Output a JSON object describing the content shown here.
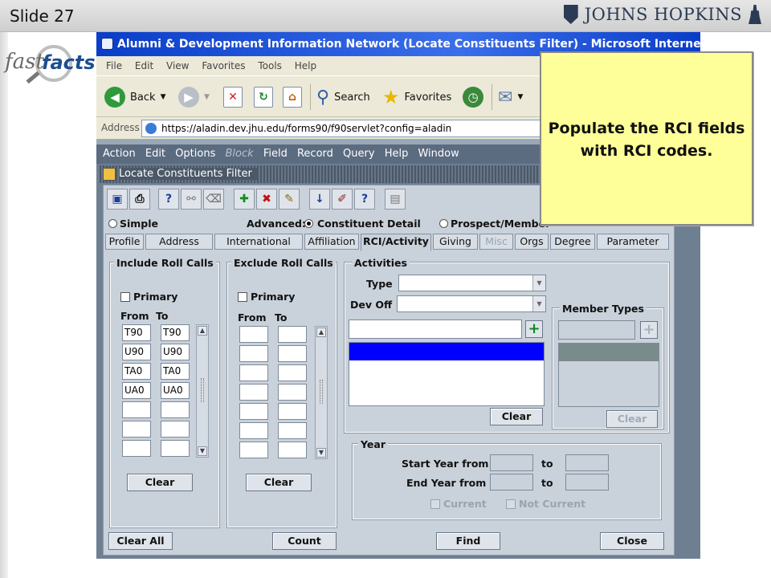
{
  "slide": {
    "number": "Slide 27",
    "logo_text": "JOHNS HOPKINS",
    "badge_fast": "fast",
    "badge_facts": "facts"
  },
  "browser": {
    "title": "Alumni & Development Information Network (Locate Constituents Filter) - Microsoft Internet Explorer",
    "menu": [
      "File",
      "Edit",
      "View",
      "Favorites",
      "Tools",
      "Help"
    ],
    "toolbar": {
      "back": "Back",
      "search": "Search",
      "favorites": "Favorites"
    },
    "address_label": "Address",
    "address_url": "https://aladin.dev.jhu.edu/forms90/f90servlet?config=aladin"
  },
  "forms_menu": [
    "Action",
    "Edit",
    "Options",
    "Block",
    "Field",
    "Record",
    "Query",
    "Help",
    "Window"
  ],
  "window_title": "Locate Constituents Filter",
  "radio": {
    "simple": "Simple",
    "advanced_label": "Advanced:",
    "constituent_detail": "Constituent Detail",
    "prospect_member": "Prospect/Member"
  },
  "tabs": [
    "Profile",
    "Address",
    "International",
    "Affiliation",
    "RCI/Activity",
    "Giving",
    "Misc",
    "Orgs",
    "Degree",
    "Parameter"
  ],
  "include_roll_calls": {
    "title": "Include Roll Calls",
    "primary": "Primary",
    "from_label": "From",
    "to_label": "To",
    "rows": [
      [
        "T90",
        "T90"
      ],
      [
        "U90",
        "U90"
      ],
      [
        "TA0",
        "TA0"
      ],
      [
        "UA0",
        "UA0"
      ],
      [
        "",
        ""
      ],
      [
        "",
        ""
      ],
      [
        "",
        ""
      ]
    ],
    "clear": "Clear"
  },
  "exclude_roll_calls": {
    "title": "Exclude Roll Calls",
    "primary": "Primary",
    "from_label": "From",
    "to_label": "To",
    "clear": "Clear"
  },
  "activities": {
    "title": "Activities",
    "type_label": "Type",
    "devoff_label": "Dev Off",
    "clear": "Clear"
  },
  "member_types": {
    "title": "Member Types",
    "clear": "Clear"
  },
  "year": {
    "title": "Year",
    "start_label": "Start Year from",
    "end_label": "End Year from",
    "to": "to",
    "current": "Current",
    "not_current": "Not Current"
  },
  "buttons": {
    "clear_all": "Clear All",
    "count": "Count",
    "find": "Find",
    "close": "Close"
  },
  "callout": {
    "line1": "Populate the RCI fields",
    "line2": "with RCI codes."
  },
  "colors": {
    "ie_blue": "#0a3dc8",
    "form_bg": "#c9d1da",
    "selection_blue": "#0000ff",
    "callout_yellow": "#ffff99"
  }
}
